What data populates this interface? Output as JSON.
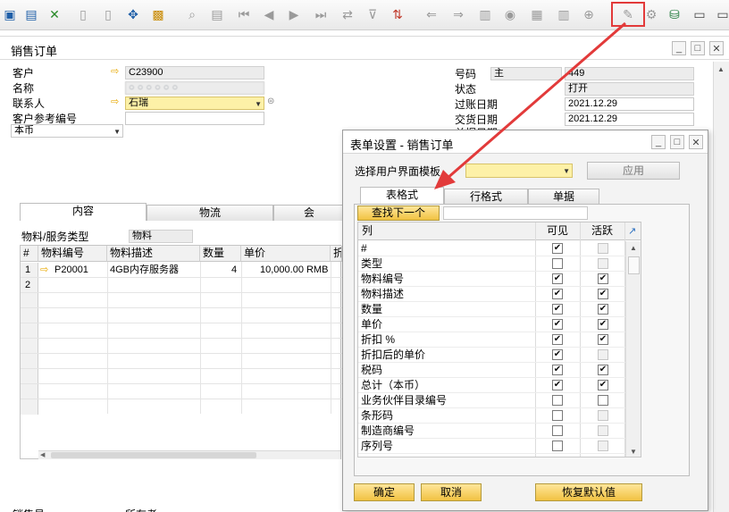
{
  "toolbar": {
    "icons": [
      "preview-icon",
      "print-icon",
      "export-excel-icon",
      "export-word-icon",
      "export-pdf-icon",
      "navigate-icon",
      "lock-icon",
      "find-icon",
      "form-icon",
      "first-record-icon",
      "previous-record-icon",
      "next-record-icon",
      "last-record-icon",
      "refresh-icon",
      "filter-icon",
      "sort-icon",
      "base-document-icon",
      "target-document-icon",
      "document-icon",
      "payment-icon",
      "gross-profit-icon",
      "journal-icon",
      "settings-search-icon",
      "form-settings-icon",
      "gear-icon",
      "db-icon",
      "message-icon",
      "alerts-icon"
    ]
  },
  "main": {
    "title": "销售订单",
    "customer_label": "客户",
    "customer_value": "C23900",
    "name_label": "名称",
    "name_value": "○ ○ ○ ○ ○ ○",
    "contact_label": "联系人",
    "contact_value": "石瑞",
    "ref_label": "客户参考编号",
    "ref_value": "",
    "currency_value": "本币",
    "number_label": "号码",
    "number_series": "主",
    "number_value": "449",
    "status_label": "状态",
    "status_value": "打开",
    "posting_date_label": "过账日期",
    "posting_date_value": "2021.12.29",
    "delivery_date_label": "交货日期",
    "delivery_date_value": "2021.12.29",
    "doc_date_label": "单据日期",
    "tabs": [
      "内容",
      "物流",
      "会"
    ],
    "item_type_label": "物料/服务类型",
    "item_type_value": "物料",
    "grid": {
      "headers": [
        "#",
        "物料编号",
        "物料描述",
        "数量",
        "单价",
        "折"
      ],
      "rows": [
        {
          "num": "1",
          "item_no": "P20001",
          "desc": "4GB内存服务器",
          "qty": "4",
          "price": "10,000.00 RMB"
        },
        {
          "num": "2",
          "item_no": "",
          "desc": "",
          "qty": "",
          "price": ""
        }
      ]
    },
    "bottom_left_label": "销售员",
    "bottom_mid_label": "所有者"
  },
  "dialog": {
    "title": "表单设置 - 销售订单",
    "template_label": "选择用户界面模板",
    "template_value": "",
    "apply_button": "应用",
    "tabs": [
      "表格式",
      "行格式",
      "单据"
    ],
    "find_next_button": "查找下一个",
    "search_value": "",
    "headers": {
      "column": "列",
      "visible": "可见",
      "active": "活跃"
    },
    "rows": [
      {
        "name": "#",
        "visible": "✔",
        "active": "",
        "active_disabled": true
      },
      {
        "name": "类型",
        "visible": "",
        "active": "",
        "active_disabled": true
      },
      {
        "name": "物料编号",
        "visible": "✔",
        "active": "✔",
        "active_disabled": false
      },
      {
        "name": "物料描述",
        "visible": "✔",
        "active": "✔",
        "active_disabled": false
      },
      {
        "name": "数量",
        "visible": "✔",
        "active": "✔",
        "active_disabled": false
      },
      {
        "name": "单价",
        "visible": "✔",
        "active": "✔",
        "active_disabled": false
      },
      {
        "name": "折扣 %",
        "visible": "✔",
        "active": "✔",
        "active_disabled": false
      },
      {
        "name": "折扣后的单价",
        "visible": "✔",
        "active": "",
        "active_disabled": true
      },
      {
        "name": "税码",
        "visible": "✔",
        "active": "✔",
        "active_disabled": false
      },
      {
        "name": "总计（本币）",
        "visible": "✔",
        "active": "✔",
        "active_disabled": false
      },
      {
        "name": "业务伙伴目录编号",
        "visible": "",
        "active": "",
        "active_disabled": false
      },
      {
        "name": "条形码",
        "visible": "",
        "active": "",
        "active_disabled": true
      },
      {
        "name": "制造商编号",
        "visible": "",
        "active": "",
        "active_disabled": true
      },
      {
        "name": "序列号",
        "visible": "",
        "active": "",
        "active_disabled": true
      }
    ],
    "ok_button": "确定",
    "cancel_button": "取消",
    "restore_button": "恢复默认值"
  },
  "colors": {
    "highlight": "#e23a3a",
    "accent_button": "#f1c242",
    "link_arrow": "#e8a800"
  }
}
